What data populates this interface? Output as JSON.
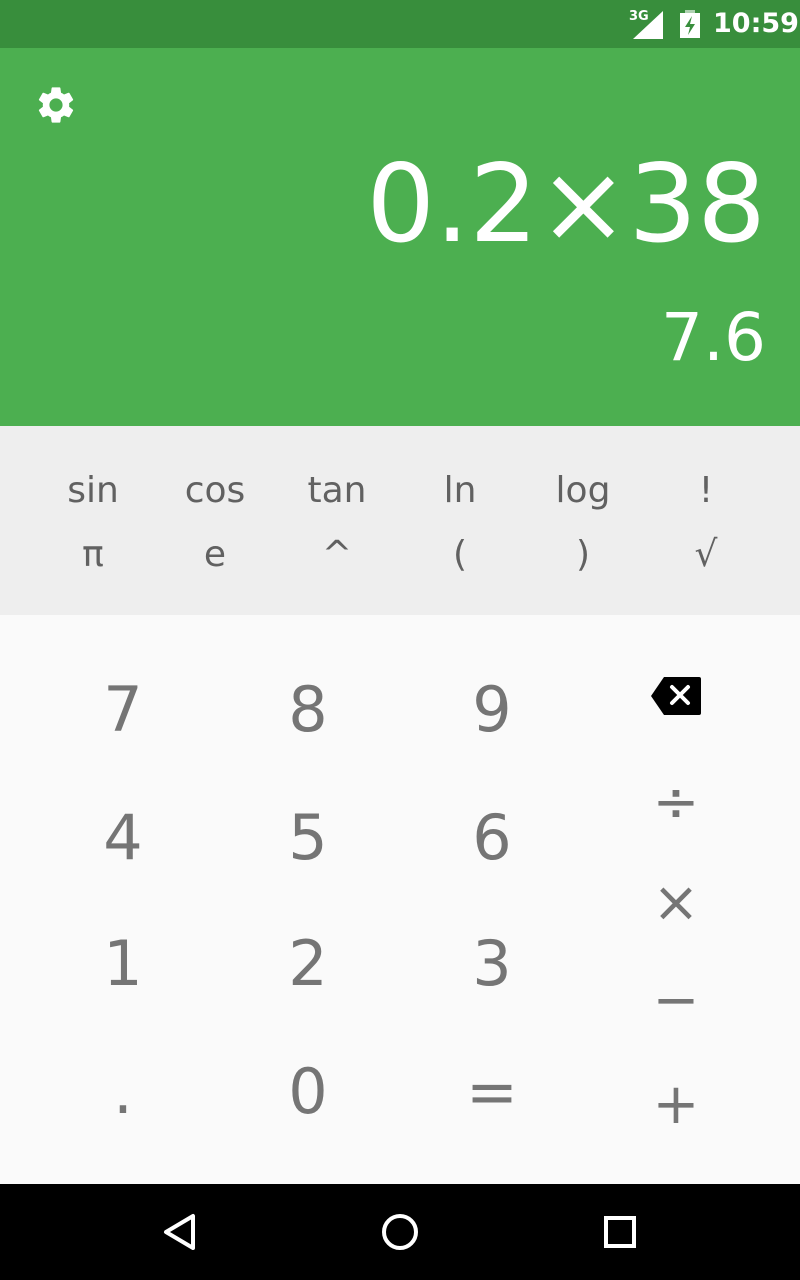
{
  "status_bar": {
    "network": "3G",
    "time": "10:59"
  },
  "display": {
    "settings_icon": "gear-icon",
    "formula": "0.2×38",
    "result": "7.6"
  },
  "advanced": {
    "row1": [
      "sin",
      "cos",
      "tan",
      "ln",
      "log",
      "!"
    ],
    "row2": [
      "π",
      "e",
      "^",
      "(",
      ")",
      "√"
    ]
  },
  "numpad": {
    "rows": [
      [
        "7",
        "8",
        "9"
      ],
      [
        "4",
        "5",
        "6"
      ],
      [
        "1",
        "2",
        "3"
      ],
      [
        ".",
        "0",
        "="
      ]
    ]
  },
  "operators": {
    "delete_icon": "backspace-icon",
    "divide": "÷",
    "multiply": "×",
    "subtract": "−",
    "add": "+"
  },
  "nav_bar": {
    "back_icon": "back-triangle-icon",
    "home_icon": "home-circle-icon",
    "recents_icon": "recents-square-icon"
  },
  "colors": {
    "status_bar": "#388e3c",
    "display_bg": "#4caf50",
    "advanced_bg": "#eeeeee",
    "pad_bg": "#fafafa",
    "key_text": "#757575"
  }
}
